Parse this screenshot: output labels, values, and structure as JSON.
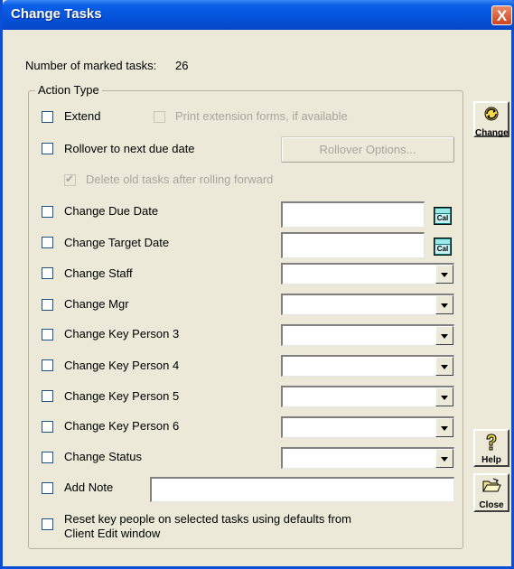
{
  "window": {
    "title": "Change Tasks",
    "close_glyph": "X"
  },
  "summary": {
    "marked_label": "Number of marked tasks:",
    "marked_count": "26"
  },
  "action_type": {
    "group_label": "Action Type",
    "extend_label": "Extend",
    "print_forms_label": "Print extension forms, if available",
    "rollover_label": "Rollover to next due date",
    "rollover_options_button": "Rollover Options...",
    "delete_old_label": "Delete old tasks after rolling forward",
    "change_due_date_label": "Change Due Date",
    "change_target_date_label": "Change Target Date",
    "change_staff_label": "Change Staff",
    "change_mgr_label": "Change Mgr",
    "change_kp3_label": "Change Key Person 3",
    "change_kp4_label": "Change Key Person 4",
    "change_kp5_label": "Change Key Person 5",
    "change_kp6_label": "Change Key Person 6",
    "change_status_label": "Change Status",
    "add_note_label": "Add Note",
    "reset_label_line1": "Reset key people on selected tasks using defaults from",
    "reset_label_line2": "Client Edit window",
    "calendar_label": "Cal"
  },
  "side_buttons": {
    "change": "Change",
    "help": "Help",
    "close": "Close"
  },
  "icons": {
    "change": "refresh-icon",
    "help": "question-icon",
    "close": "folder-open-icon",
    "calendar": "calendar-icon"
  },
  "colors": {
    "titlebar": "#0552da",
    "close_button": "#d2421e",
    "face": "#ece9d8",
    "disabled_text": "#a8a69b"
  }
}
